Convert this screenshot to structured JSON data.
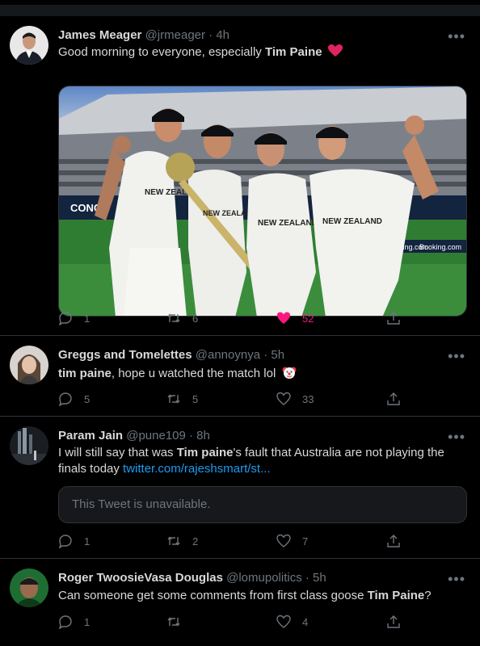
{
  "colors": {
    "background": "#000000",
    "text": "#d9d9d9",
    "muted": "#6e767d",
    "link": "#1d9bf0",
    "like": "#f91880",
    "divider": "#2f3336"
  },
  "tweets": [
    {
      "name": "James Meager",
      "handle": "@jrmeager",
      "time": "· 4h",
      "text_before": "Good morning to everyone, especially ",
      "text_bold": "Tim Paine",
      "emoji": "red-heart",
      "media": "photo-cricket-team-trophy",
      "media_text": {
        "banner": "CONCU",
        "kit1": "NEW ZEALAND",
        "kit2": "NEW ZEALAND",
        "kit3": "NEW ZEALAND",
        "kit4": "NEW ZEALAND",
        "board1": "Booking.com",
        "board2": "Booking.com"
      },
      "replies": "1",
      "retweets": "6",
      "likes": "52",
      "liked": true
    },
    {
      "name": "Greggs and Tomelettes",
      "handle": "@annoynya",
      "time": "· 5h",
      "text_bold": "tim paine",
      "text_after": ", hope u watched the match lol",
      "emoji": "clown-face",
      "replies": "5",
      "retweets": "5",
      "likes": "33"
    },
    {
      "name": "Param Jain",
      "handle": "@pune109",
      "time": "· 8h",
      "text_before": "I will still say that was ",
      "text_bold": "Tim paine",
      "text_after": "'s fault that Australia are not playing the finals today ",
      "link": "twitter.com/rajeshsmart/st...",
      "unavailable": "This Tweet is unavailable.",
      "replies": "1",
      "retweets": "2",
      "likes": "7"
    },
    {
      "name": "Roger TwoosieVasa Douglas",
      "handle": "@lomupolitics",
      "time": "· 5h",
      "text_before": "Can someone get some comments from first class goose ",
      "text_bold": "Tim Paine",
      "text_after": "?",
      "replies": "1",
      "retweets": "",
      "likes": "4"
    }
  ],
  "more_glyph": "•••"
}
